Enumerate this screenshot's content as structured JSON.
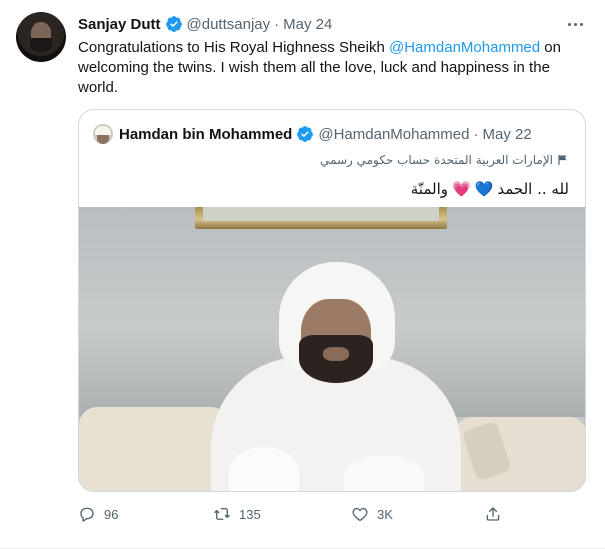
{
  "tweet": {
    "author_name": "Sanjay Dutt",
    "handle": "@duttsanjay",
    "separator": "·",
    "date": "May 24",
    "text_before": "Congratulations to His Royal Highness Sheikh ",
    "mention": "@HamdanMohammed",
    "text_after": " on welcoming the twins. I wish them all the love, luck and happiness in the world.",
    "avatar_icon": "avatar-photo",
    "more_icon": "ellipsis-icon"
  },
  "quote": {
    "author_name": "Hamdan bin Mohammed",
    "handle": "@HamdanMohammed",
    "separator": "·",
    "date": "May 22",
    "label": "الإمارات العربية المتحدة حساب حكومي رسمي",
    "text_part1": "لله .. الحمد",
    "blue_heart": "💙",
    "pink_heart": "💗",
    "text_part2": "والمنّة"
  },
  "actions": {
    "reply_count": "96",
    "retweet_count": "135",
    "like_count": "3K"
  },
  "colors": {
    "accent": "#1d9bf0",
    "muted": "#536471",
    "border": "#cfd9de"
  }
}
